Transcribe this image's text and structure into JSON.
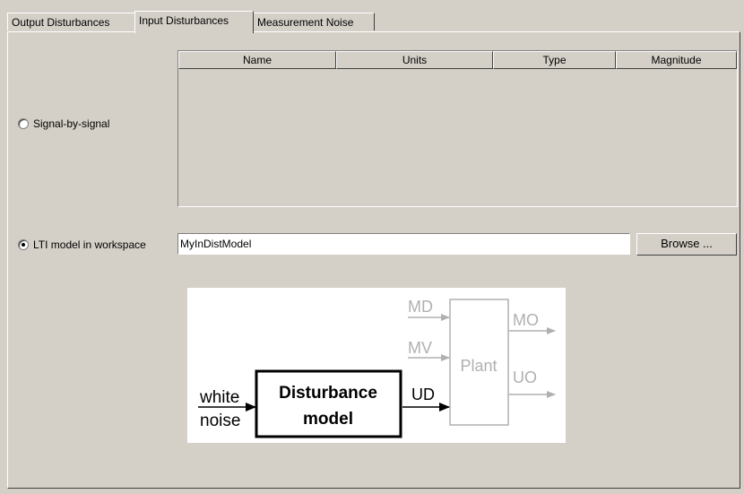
{
  "tabs": [
    {
      "label": "Output Disturbances",
      "active": false
    },
    {
      "label": "Input Disturbances",
      "active": true
    },
    {
      "label": "Measurement Noise",
      "active": false
    }
  ],
  "signal_option": {
    "label": "Signal-by-signal",
    "checked": false
  },
  "table": {
    "columns": [
      "Name",
      "Units",
      "Type",
      "Magnitude"
    ],
    "rows": []
  },
  "lti_option": {
    "label": "LTI model in workspace",
    "checked": true
  },
  "model_input": {
    "value": "MyInDistModel"
  },
  "browse_button": {
    "label": "Browse ..."
  },
  "diagram": {
    "md": "MD",
    "mv": "MV",
    "ud": "UD",
    "plant": "Plant",
    "mo": "MO",
    "uo": "UO",
    "white": "white",
    "noise": "noise",
    "dist1": "Disturbance",
    "dist2": "model"
  },
  "colors": {
    "background": "#d4d0c8",
    "gray_text": "#b0b0b0"
  }
}
